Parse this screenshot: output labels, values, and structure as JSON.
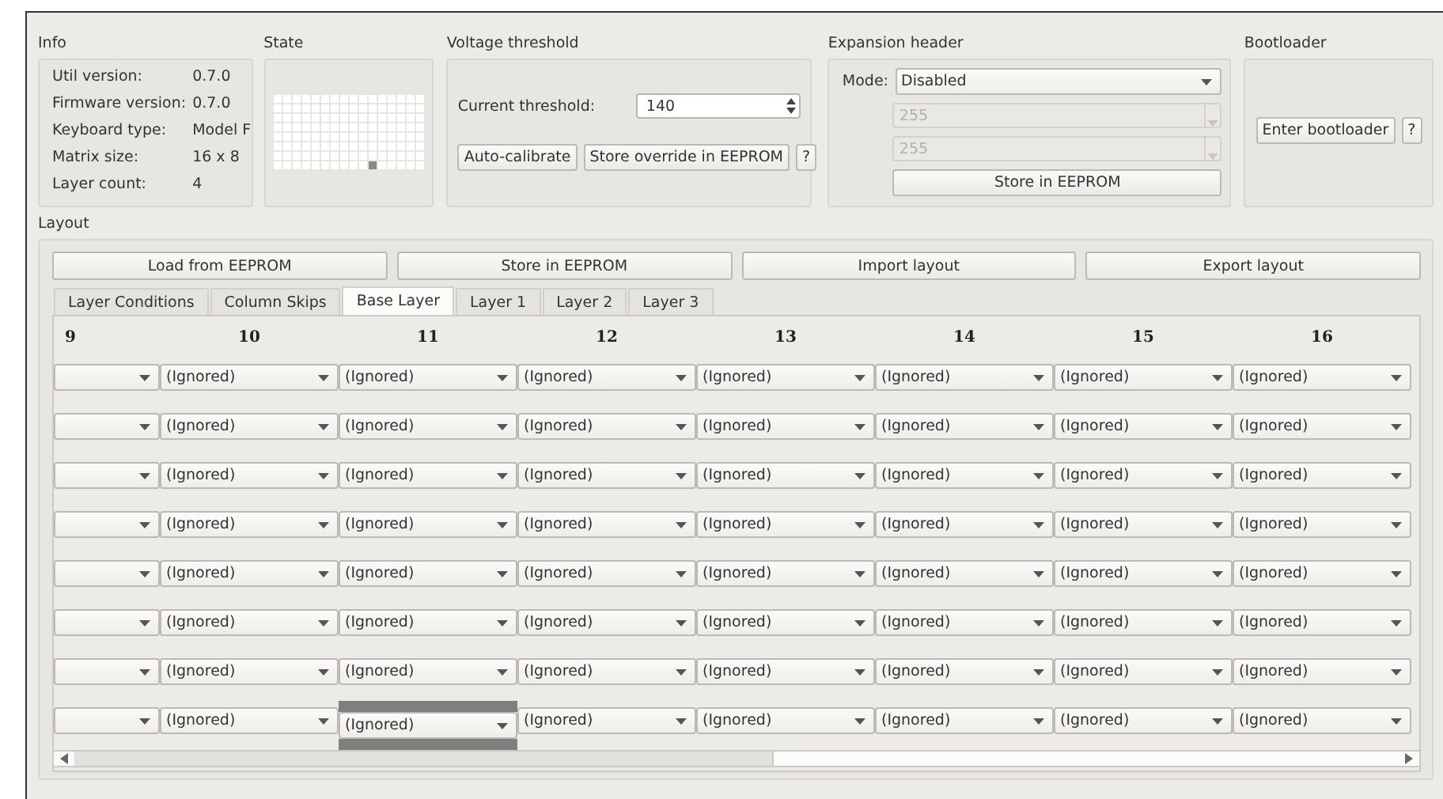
{
  "info": {
    "title": "Info",
    "rows": [
      {
        "label": "Util version:",
        "value": "0.7.0"
      },
      {
        "label": "Firmware version:",
        "value": "0.7.0"
      },
      {
        "label": "Keyboard type:",
        "value": "Model F"
      },
      {
        "label": "Matrix size:",
        "value": "16 x 8"
      },
      {
        "label": "Layer count:",
        "value": "4"
      }
    ]
  },
  "state": {
    "title": "State",
    "matrix": [
      {
        "keys": [
          {
            "pressed": false
          },
          {
            "pressed": false
          },
          {
            "pressed": false
          },
          {
            "pressed": false
          },
          {
            "pressed": false
          },
          {
            "pressed": false
          },
          {
            "pressed": false
          },
          {
            "pressed": false
          },
          {
            "pressed": false
          },
          {
            "pressed": false
          },
          {
            "pressed": false
          },
          {
            "pressed": false
          },
          {
            "pressed": false
          },
          {
            "pressed": false
          },
          {
            "pressed": false
          },
          {
            "pressed": false
          }
        ]
      },
      {
        "keys": [
          {
            "pressed": false
          },
          {
            "pressed": false
          },
          {
            "pressed": false
          },
          {
            "pressed": false
          },
          {
            "pressed": false
          },
          {
            "pressed": false
          },
          {
            "pressed": false
          },
          {
            "pressed": false
          },
          {
            "pressed": false
          },
          {
            "pressed": false
          },
          {
            "pressed": false
          },
          {
            "pressed": false
          },
          {
            "pressed": false
          },
          {
            "pressed": false
          },
          {
            "pressed": false
          },
          {
            "pressed": false
          }
        ]
      },
      {
        "keys": [
          {
            "pressed": false
          },
          {
            "pressed": false
          },
          {
            "pressed": false
          },
          {
            "pressed": false
          },
          {
            "pressed": false
          },
          {
            "pressed": false
          },
          {
            "pressed": false
          },
          {
            "pressed": false
          },
          {
            "pressed": false
          },
          {
            "pressed": false
          },
          {
            "pressed": false
          },
          {
            "pressed": false
          },
          {
            "pressed": false
          },
          {
            "pressed": false
          },
          {
            "pressed": false
          },
          {
            "pressed": false
          }
        ]
      },
      {
        "keys": [
          {
            "pressed": false
          },
          {
            "pressed": false
          },
          {
            "pressed": false
          },
          {
            "pressed": false
          },
          {
            "pressed": false
          },
          {
            "pressed": false
          },
          {
            "pressed": false
          },
          {
            "pressed": false
          },
          {
            "pressed": false
          },
          {
            "pressed": false
          },
          {
            "pressed": false
          },
          {
            "pressed": false
          },
          {
            "pressed": false
          },
          {
            "pressed": false
          },
          {
            "pressed": false
          },
          {
            "pressed": false
          }
        ]
      },
      {
        "keys": [
          {
            "pressed": false
          },
          {
            "pressed": false
          },
          {
            "pressed": false
          },
          {
            "pressed": false
          },
          {
            "pressed": false
          },
          {
            "pressed": false
          },
          {
            "pressed": false
          },
          {
            "pressed": false
          },
          {
            "pressed": false
          },
          {
            "pressed": false
          },
          {
            "pressed": false
          },
          {
            "pressed": false
          },
          {
            "pressed": false
          },
          {
            "pressed": false
          },
          {
            "pressed": false
          },
          {
            "pressed": false
          }
        ]
      },
      {
        "keys": [
          {
            "pressed": false
          },
          {
            "pressed": false
          },
          {
            "pressed": false
          },
          {
            "pressed": false
          },
          {
            "pressed": false
          },
          {
            "pressed": false
          },
          {
            "pressed": false
          },
          {
            "pressed": false
          },
          {
            "pressed": false
          },
          {
            "pressed": false
          },
          {
            "pressed": false
          },
          {
            "pressed": false
          },
          {
            "pressed": false
          },
          {
            "pressed": false
          },
          {
            "pressed": false
          },
          {
            "pressed": false
          }
        ]
      },
      {
        "keys": [
          {
            "pressed": false
          },
          {
            "pressed": false
          },
          {
            "pressed": false
          },
          {
            "pressed": false
          },
          {
            "pressed": false
          },
          {
            "pressed": false
          },
          {
            "pressed": false
          },
          {
            "pressed": false
          },
          {
            "pressed": false
          },
          {
            "pressed": false
          },
          {
            "pressed": false
          },
          {
            "pressed": false
          },
          {
            "pressed": false
          },
          {
            "pressed": false
          },
          {
            "pressed": false
          },
          {
            "pressed": false
          }
        ]
      },
      {
        "keys": [
          {
            "pressed": false
          },
          {
            "pressed": false
          },
          {
            "pressed": false
          },
          {
            "pressed": false
          },
          {
            "pressed": false
          },
          {
            "pressed": false
          },
          {
            "pressed": false
          },
          {
            "pressed": false
          },
          {
            "pressed": false
          },
          {
            "pressed": false
          },
          {
            "pressed": true
          },
          {
            "pressed": false
          },
          {
            "pressed": false
          },
          {
            "pressed": false
          },
          {
            "pressed": false
          },
          {
            "pressed": false
          }
        ]
      }
    ]
  },
  "voltage_threshold": {
    "title": "Voltage threshold",
    "label": "Current threshold:",
    "value": "140",
    "buttons": [
      "Auto-calibrate",
      "Store override in EEPROM",
      "?"
    ]
  },
  "expansion_header": {
    "title": "Expansion header",
    "mode_label": "Mode:",
    "mode": "Disabled",
    "fields": [
      {
        "value": "255",
        "disabled": true
      },
      {
        "value": "255",
        "disabled": true
      }
    ],
    "button": "Store in EEPROM"
  },
  "bootloader": {
    "title": "Bootloader",
    "buttons": [
      "Enter bootloader",
      "?"
    ]
  },
  "layout": {
    "title": "Layout",
    "buttons": [
      "Load from EEPROM",
      "Store in EEPROM",
      "Import layout",
      "Export layout"
    ],
    "tabs": [
      {
        "label": "Layer Conditions",
        "selected": false
      },
      {
        "label": "Column Skips",
        "selected": false
      },
      {
        "label": "Base Layer",
        "selected": true
      },
      {
        "label": "Layer 1",
        "selected": false
      },
      {
        "label": "Layer 2",
        "selected": false
      },
      {
        "label": "Layer 3",
        "selected": false
      }
    ],
    "table": {
      "columns": [
        "9",
        "10",
        "11",
        "12",
        "13",
        "14",
        "15",
        "16"
      ],
      "rows": [
        {
          "cells": [
            {
              "selected": false
            },
            {
              "value": "(Ignored)",
              "selected": false
            },
            {
              "value": "(Ignored)",
              "selected": false
            },
            {
              "value": "(Ignored)",
              "selected": false
            },
            {
              "value": "(Ignored)",
              "selected": false
            },
            {
              "value": "(Ignored)",
              "selected": false
            },
            {
              "value": "(Ignored)",
              "selected": false
            },
            {
              "value": "(Ignored)",
              "selected": false
            }
          ]
        },
        {
          "cells": [
            {
              "selected": false
            },
            {
              "value": "(Ignored)",
              "selected": false
            },
            {
              "value": "(Ignored)",
              "selected": false
            },
            {
              "value": "(Ignored)",
              "selected": false
            },
            {
              "value": "(Ignored)",
              "selected": false
            },
            {
              "value": "(Ignored)",
              "selected": false
            },
            {
              "value": "(Ignored)",
              "selected": false
            },
            {
              "value": "(Ignored)",
              "selected": false
            }
          ]
        },
        {
          "cells": [
            {
              "selected": false
            },
            {
              "value": "(Ignored)",
              "selected": false
            },
            {
              "value": "(Ignored)",
              "selected": false
            },
            {
              "value": "(Ignored)",
              "selected": false
            },
            {
              "value": "(Ignored)",
              "selected": false
            },
            {
              "value": "(Ignored)",
              "selected": false
            },
            {
              "value": "(Ignored)",
              "selected": false
            },
            {
              "value": "(Ignored)",
              "selected": false
            }
          ]
        },
        {
          "cells": [
            {
              "selected": false
            },
            {
              "value": "(Ignored)",
              "selected": false
            },
            {
              "value": "(Ignored)",
              "selected": false
            },
            {
              "value": "(Ignored)",
              "selected": false
            },
            {
              "value": "(Ignored)",
              "selected": false
            },
            {
              "value": "(Ignored)",
              "selected": false
            },
            {
              "value": "(Ignored)",
              "selected": false
            },
            {
              "value": "(Ignored)",
              "selected": false
            }
          ]
        },
        {
          "cells": [
            {
              "selected": false
            },
            {
              "value": "(Ignored)",
              "selected": false
            },
            {
              "value": "(Ignored)",
              "selected": false
            },
            {
              "value": "(Ignored)",
              "selected": false
            },
            {
              "value": "(Ignored)",
              "selected": false
            },
            {
              "value": "(Ignored)",
              "selected": false
            },
            {
              "value": "(Ignored)",
              "selected": false
            },
            {
              "value": "(Ignored)",
              "selected": false
            }
          ]
        },
        {
          "cells": [
            {
              "selected": false
            },
            {
              "value": "(Ignored)",
              "selected": false
            },
            {
              "value": "(Ignored)",
              "selected": false
            },
            {
              "value": "(Ignored)",
              "selected": false
            },
            {
              "value": "(Ignored)",
              "selected": false
            },
            {
              "value": "(Ignored)",
              "selected": false
            },
            {
              "value": "(Ignored)",
              "selected": false
            },
            {
              "value": "(Ignored)",
              "selected": false
            }
          ]
        },
        {
          "cells": [
            {
              "selected": false
            },
            {
              "value": "(Ignored)",
              "selected": false
            },
            {
              "value": "(Ignored)",
              "selected": false
            },
            {
              "value": "(Ignored)",
              "selected": false
            },
            {
              "value": "(Ignored)",
              "selected": false
            },
            {
              "value": "(Ignored)",
              "selected": false
            },
            {
              "value": "(Ignored)",
              "selected": false
            },
            {
              "value": "(Ignored)",
              "selected": false
            }
          ]
        },
        {
          "cells": [
            {
              "selected": false
            },
            {
              "value": "(Ignored)",
              "selected": false
            },
            {
              "value": "(Ignored)",
              "selected": true
            },
            {
              "value": "(Ignored)",
              "selected": false
            },
            {
              "value": "(Ignored)",
              "selected": false
            },
            {
              "value": "(Ignored)",
              "selected": false
            },
            {
              "value": "(Ignored)",
              "selected": false
            },
            {
              "value": "(Ignored)",
              "selected": false
            }
          ]
        }
      ]
    }
  }
}
